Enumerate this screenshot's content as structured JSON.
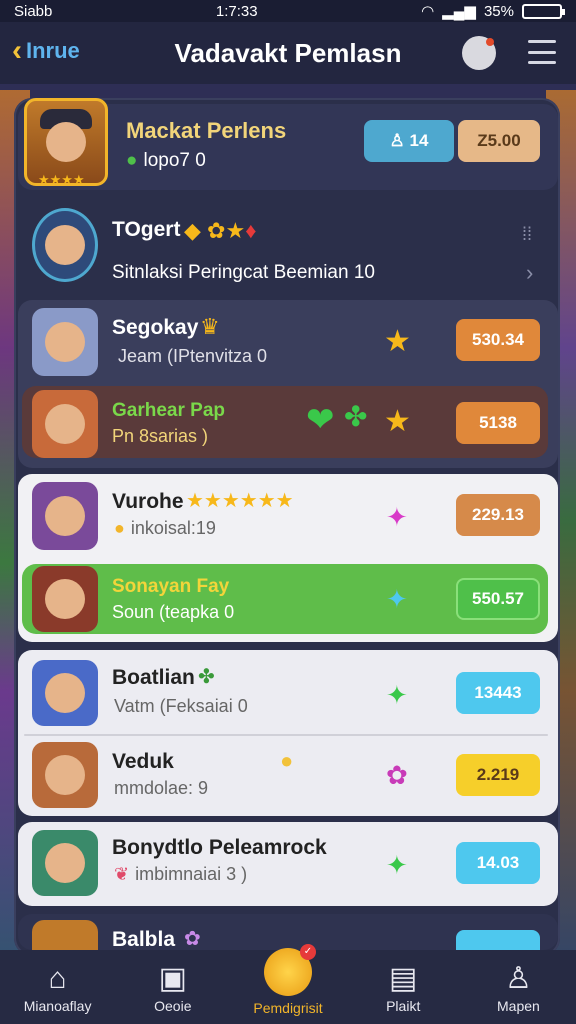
{
  "status_bar": {
    "left": "Siabb",
    "time": "1:7:33",
    "battery": "35%"
  },
  "header": {
    "back_label": "Inrue",
    "title": "Vadavakt Pemlasn"
  },
  "featured": {
    "name": "Mackat Perlens",
    "sub": "lopo7 0",
    "btn_left": "14",
    "btn_right": "Z5.00"
  },
  "target": {
    "name": "TOgert",
    "sub": "Sitnlaksi Peringcat Beemian 10"
  },
  "rows": [
    {
      "name": "Segokay",
      "sub": "Jeam (IPtenvitza 0",
      "score": "530.34",
      "score_color": "#e0883a"
    },
    {
      "name": "Garhear Pap",
      "sub": "Pn  8sarias )",
      "score": "5138",
      "score_color": "#e0883a"
    },
    {
      "name": "Vurohe",
      "sub": "inkoisal:19",
      "score": "229.13",
      "score_color": "#d68a4a"
    },
    {
      "name": "Sonayan Fay",
      "sub": "Soun  (teapka 0",
      "score": "550.57",
      "score_color": "#4fc04a"
    },
    {
      "name": "Boatlian",
      "sub": "Vatm (Feksaiai 0",
      "score": "13443",
      "score_color": "#4ec8ee"
    },
    {
      "name": "Veduk",
      "sub": "mmdolae: 9",
      "score": "2.219",
      "score_color": "#f6cf2a"
    },
    {
      "name": "Bonydtlo Peleamrock",
      "sub": "imbimnaiai 3 )",
      "score": "14.03",
      "score_color": "#4ec8ee"
    },
    {
      "name": "Balbla",
      "sub": "",
      "score": "",
      "score_color": "#4ec8ee"
    }
  ],
  "nav": [
    {
      "label": "Mianoaflay",
      "icon": "home-icon"
    },
    {
      "label": "Oeoie",
      "icon": "inventory-icon"
    },
    {
      "label": "Pemdigrisit",
      "icon": "coin-icon"
    },
    {
      "label": "Plaikt",
      "icon": "map-icon"
    },
    {
      "label": "Mapen",
      "icon": "profile-icon"
    }
  ],
  "colors": {
    "accent": "#f2b52a",
    "panel": "#2b2f4a",
    "header": "#232640"
  }
}
